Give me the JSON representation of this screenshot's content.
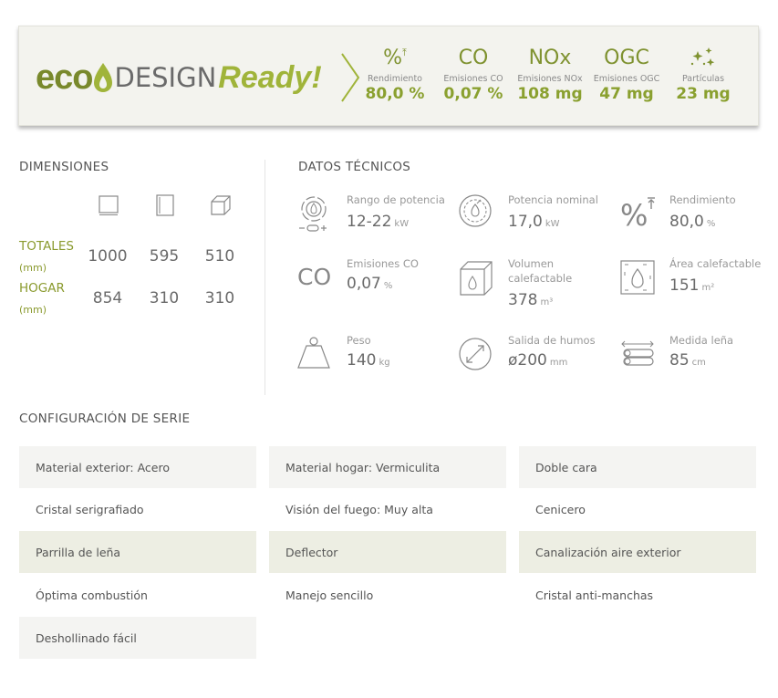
{
  "eco": {
    "logo_eco": "eco",
    "logo_design": "DESIGN",
    "logo_ready": "Ready!",
    "stats": [
      {
        "symbol": "%",
        "label": "Rendimiento",
        "value": "80,0 %"
      },
      {
        "symbol": "CO",
        "label": "Emisiones CO",
        "value": "0,07 %"
      },
      {
        "symbol": "NOx",
        "label": "Emisiones NOx",
        "value": "108 mg"
      },
      {
        "symbol": "OGC",
        "label": "Emisiones OGC",
        "value": "47 mg"
      },
      {
        "symbol": "particles-icon",
        "label": "Partículas",
        "value": "23 mg"
      }
    ]
  },
  "dimensions": {
    "title": "DIMENSIONES",
    "rows": [
      {
        "label": "TOTALES",
        "unit": "(mm)",
        "values": [
          "1000",
          "595",
          "510"
        ]
      },
      {
        "label": "HOGAR",
        "unit": "(mm)",
        "values": [
          "854",
          "310",
          "310"
        ]
      }
    ]
  },
  "tech": {
    "title": "DATOS TÉCNICOS",
    "items": [
      {
        "icon": "power-range-icon",
        "label": "Rango de potencia",
        "value": "12-22",
        "unit": "kW"
      },
      {
        "icon": "nominal-power-icon",
        "label": "Potencia nominal",
        "value": "17,0",
        "unit": "kW"
      },
      {
        "icon": "efficiency-icon",
        "label": "Rendimiento",
        "value": "80,0",
        "unit": "%"
      },
      {
        "icon": "co-icon",
        "label": "Emisiones CO",
        "value": "0,07",
        "unit": "%"
      },
      {
        "icon": "volume-icon",
        "label": "Volumen calefactable",
        "value": "378",
        "unit": "m³"
      },
      {
        "icon": "area-icon",
        "label": "Área calefactable",
        "value": "151",
        "unit": "m²"
      },
      {
        "icon": "weight-icon",
        "label": "Peso",
        "value": "140",
        "unit": "kg"
      },
      {
        "icon": "flue-icon",
        "label": "Salida de humos",
        "value": "ø200",
        "unit": "mm"
      },
      {
        "icon": "firewood-icon",
        "label": "Medida leña",
        "value": "85",
        "unit": "cm"
      }
    ],
    "co_symbol": "CO"
  },
  "config": {
    "title": "CONFIGURACIÓN DE SERIE",
    "items": [
      "Material exterior: Acero",
      "Material hogar: Vermiculita",
      "Doble cara",
      "Cristal serigrafiado",
      "Visión del fuego: Muy alta",
      "Cenicero",
      "Parrilla de leña",
      "Deflector",
      "Canalización aire exterior",
      "Óptima combustión",
      "Manejo sencillo",
      "Cristal anti-manchas",
      "Deshollinado fácil"
    ]
  },
  "colors": {
    "accent": "#8aa02f",
    "dark_accent": "#79892c",
    "olive_bg": "#edeee3",
    "light_bg": "#f4f4f2"
  }
}
